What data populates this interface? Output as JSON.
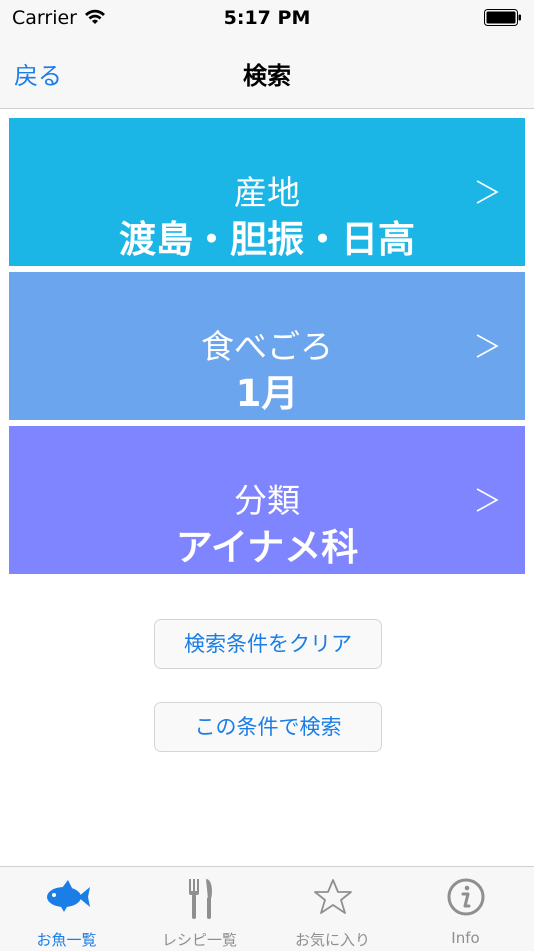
{
  "status_bar": {
    "carrier": "Carrier",
    "time": "5:17 PM"
  },
  "nav": {
    "back_label": "戻る",
    "title": "検索"
  },
  "panels": [
    {
      "label": "産地",
      "value": "渡島・胆振・日高",
      "color": "#1cb6e6"
    },
    {
      "label": "食べごろ",
      "value": "1月",
      "color": "#6aa5ed"
    },
    {
      "label": "分類",
      "value": "アイナメ科",
      "color": "#7f84ff"
    }
  ],
  "actions": {
    "clear_label": "検索条件をクリア",
    "search_label": "この条件で検索"
  },
  "tabs": [
    {
      "label": "お魚一覧",
      "icon": "fish-icon",
      "active": true
    },
    {
      "label": "レシピ一覧",
      "icon": "fork-knife-icon",
      "active": false
    },
    {
      "label": "お気に入り",
      "icon": "star-icon",
      "active": false
    },
    {
      "label": "Info",
      "icon": "info-icon",
      "active": false
    }
  ],
  "colors": {
    "accent": "#1a7ee6",
    "inactive": "#8f8f8f"
  }
}
